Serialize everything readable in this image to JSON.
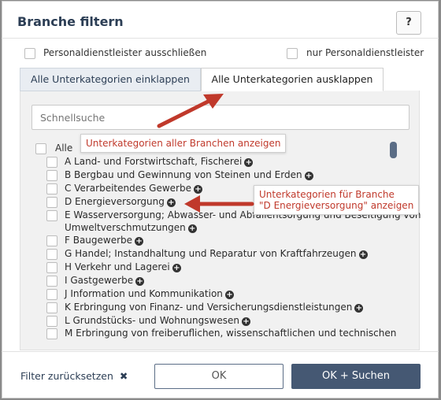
{
  "dialog": {
    "title": "Branche filtern",
    "help_label": "?"
  },
  "options": {
    "exclude_label": "Personaldienstleister ausschließen",
    "only_label": "nur Personaldienstleister"
  },
  "tabs": {
    "collapse_label": "Alle Unterkategorien einklappen",
    "expand_label": "Alle Unterkategorien ausklappen"
  },
  "search": {
    "placeholder": "Schnellsuche"
  },
  "list": {
    "all_label": "Alle",
    "items": [
      "A Land- und Forstwirtschaft, Fischerei",
      "B Bergbau und Gewinnung von Steinen und Erden",
      "C Verarbeitendes Gewerbe",
      "D Energieversorgung",
      "E Wasserversorgung; Abwasser- und Abfallentsorgung und Beseitigung von",
      "Umweltverschmutzungen",
      "F Baugewerbe",
      "G Handel; Instandhaltung und Reparatur von Kraftfahrzeugen",
      "H Verkehr und Lagerei",
      "I Gastgewerbe",
      "J Information und Kommunikation",
      "K Erbringung von Finanz- und Versicherungsdienstleistungen",
      "L Grundstücks- und Wohnungswesen",
      "M Erbringung von freiberuflichen, wissenschaftlichen und technischen"
    ]
  },
  "annotations": {
    "expand_note": "Unterkategorien aller Branchen anzeigen",
    "branch_note_line1": "Unterkategorien für Branche",
    "branch_note_line2": "\"D Energieversorgung\" anzeigen",
    "arrow_color": "#c0392b"
  },
  "footer": {
    "reset_label": "Filter zurücksetzen",
    "reset_icon": "✖",
    "ok_label": "OK",
    "ok_search_label": "OK + Suchen"
  },
  "icons": {
    "expand": "+"
  }
}
